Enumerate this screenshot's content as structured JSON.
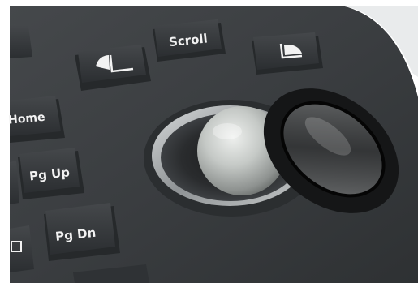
{
  "photo": {
    "subject": "keyboard with trackball",
    "colors": {
      "background": "#ffffff",
      "panel": "#3a3d40",
      "panel_light": "#4a4d50",
      "key": "#2f3235",
      "key_top": "#3b3e41",
      "key_text": "#f2f2f2",
      "ball": "#c8ccc9",
      "ring": "#151617",
      "metal": "#a9adaf"
    }
  },
  "keys": {
    "scroll": "Scroll",
    "home": "Home",
    "pg_up": "Pg Up",
    "pg_dn": "Pg Dn"
  },
  "icons": {
    "left_click": "left-mouse-button-icon",
    "right_click": "right-mouse-button-icon",
    "partial_key": "square-icon"
  }
}
